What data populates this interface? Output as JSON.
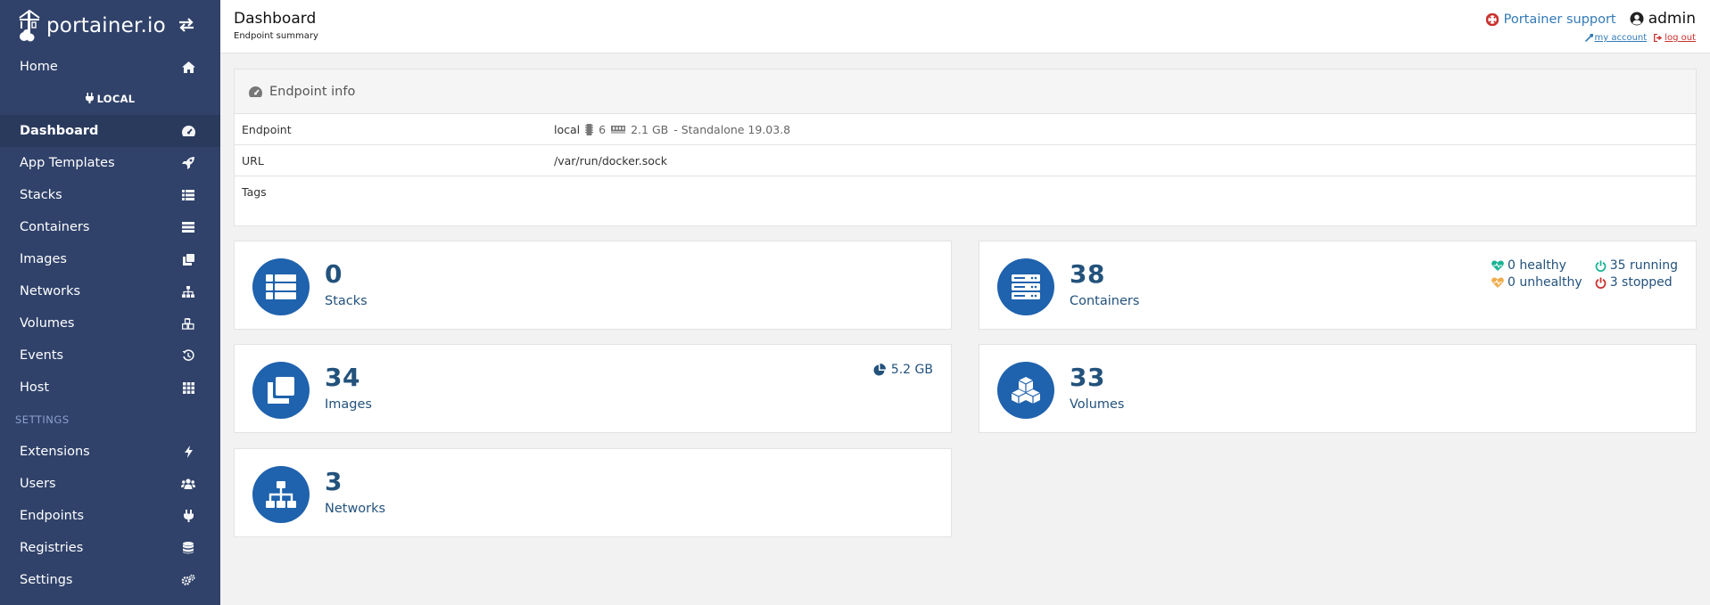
{
  "brand": {
    "name": "portainer.io"
  },
  "sidebar": {
    "home": "Home",
    "endpoint_label": "LOCAL",
    "items": [
      {
        "label": "Dashboard",
        "icon": "tachometer-icon"
      },
      {
        "label": "App Templates",
        "icon": "rocket-icon"
      },
      {
        "label": "Stacks",
        "icon": "th-list-icon"
      },
      {
        "label": "Containers",
        "icon": "server-icon"
      },
      {
        "label": "Images",
        "icon": "clone-icon"
      },
      {
        "label": "Networks",
        "icon": "sitemap-icon"
      },
      {
        "label": "Volumes",
        "icon": "cubes-icon"
      },
      {
        "label": "Events",
        "icon": "history-icon"
      },
      {
        "label": "Host",
        "icon": "th-icon"
      }
    ],
    "settings_title": "SETTINGS",
    "settings_items": [
      {
        "label": "Extensions",
        "icon": "bolt-icon"
      },
      {
        "label": "Users",
        "icon": "users-icon"
      },
      {
        "label": "Endpoints",
        "icon": "plug-icon"
      },
      {
        "label": "Registries",
        "icon": "database-icon"
      },
      {
        "label": "Settings",
        "icon": "cogs-icon"
      }
    ]
  },
  "header": {
    "title": "Dashboard",
    "subtitle": "Endpoint summary",
    "support": "Portainer support",
    "user": "admin",
    "my_account": "my account",
    "log_out": "log out"
  },
  "endpoint_info": {
    "title": "Endpoint info",
    "rows": {
      "endpoint_label": "Endpoint",
      "endpoint_name": "local",
      "cpu": "6",
      "memory": "2.1 GB",
      "mode": "- Standalone 19.03.8",
      "url_label": "URL",
      "url": "/var/run/docker.sock",
      "tags_label": "Tags",
      "tags": ""
    }
  },
  "widgets": {
    "stacks": {
      "count": "0",
      "label": "Stacks"
    },
    "containers": {
      "count": "38",
      "label": "Containers",
      "healthy": "0 healthy",
      "running": "35 running",
      "unhealthy": "0 unhealthy",
      "stopped": "3 stopped"
    },
    "images": {
      "count": "34",
      "label": "Images",
      "size": "5.2 GB"
    },
    "volumes": {
      "count": "33",
      "label": "Volumes"
    },
    "networks": {
      "count": "3",
      "label": "Networks"
    }
  },
  "colors": {
    "sidebar_bg": "#30426a",
    "accent": "#1f62ad",
    "link": "#337ab7",
    "healthy": "#1ab394",
    "running": "#1ab394",
    "unhealthy": "#f0ad4e",
    "stopped": "#c9302c"
  }
}
